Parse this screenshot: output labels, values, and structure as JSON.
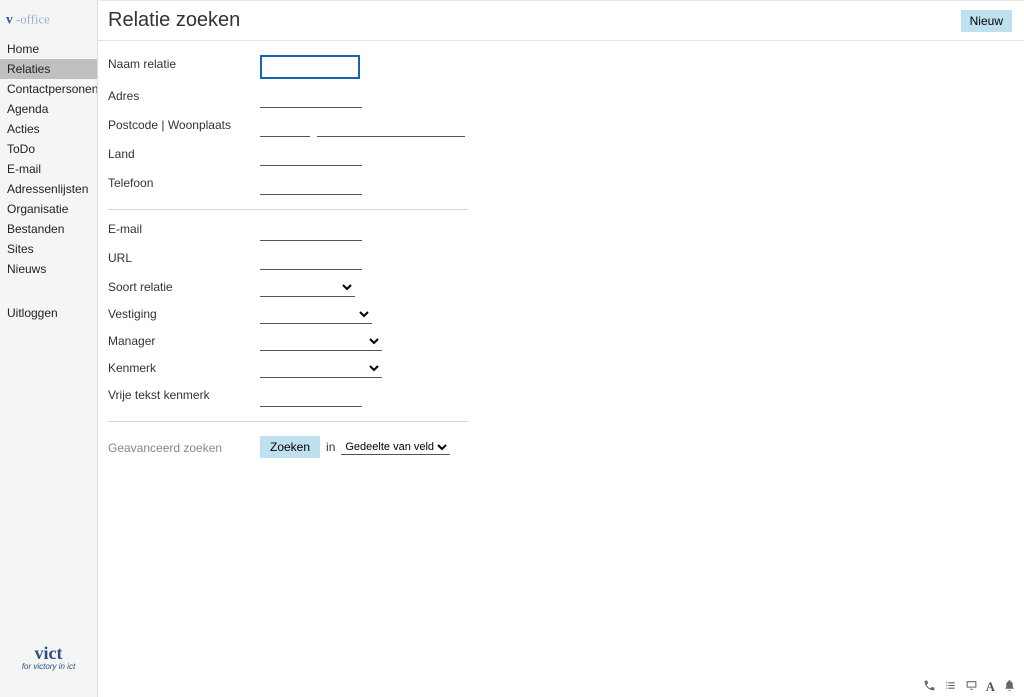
{
  "app_name": "v-office",
  "header": {
    "title": "Relatie zoeken",
    "new_button": "Nieuw"
  },
  "sidebar": {
    "items": [
      "Home",
      "Relaties",
      "Contactpersonen",
      "Agenda",
      "Acties",
      "ToDo",
      "E-mail",
      "Adressenlijsten",
      "Organisatie",
      "Bestanden",
      "Sites",
      "Nieuws"
    ],
    "logout": "Uitloggen"
  },
  "form": {
    "naam_relatie": "Naam relatie",
    "adres": "Adres",
    "postcode_woonplaats": "Postcode | Woonplaats",
    "land": "Land",
    "telefoon": "Telefoon",
    "email": "E-mail",
    "url": "URL",
    "soort_relatie": "Soort relatie",
    "vestiging": "Vestiging",
    "manager": "Manager",
    "kenmerk": "Kenmerk",
    "vrije_tekst_kenmerk": "Vrije tekst kenmerk"
  },
  "advanced": {
    "label": "Geavanceerd zoeken",
    "search_button": "Zoeken",
    "in": "in",
    "scope_options": [
      "Gedeelte van veld"
    ]
  },
  "brand": {
    "name": "vict",
    "tagline": "for victory in ict"
  }
}
